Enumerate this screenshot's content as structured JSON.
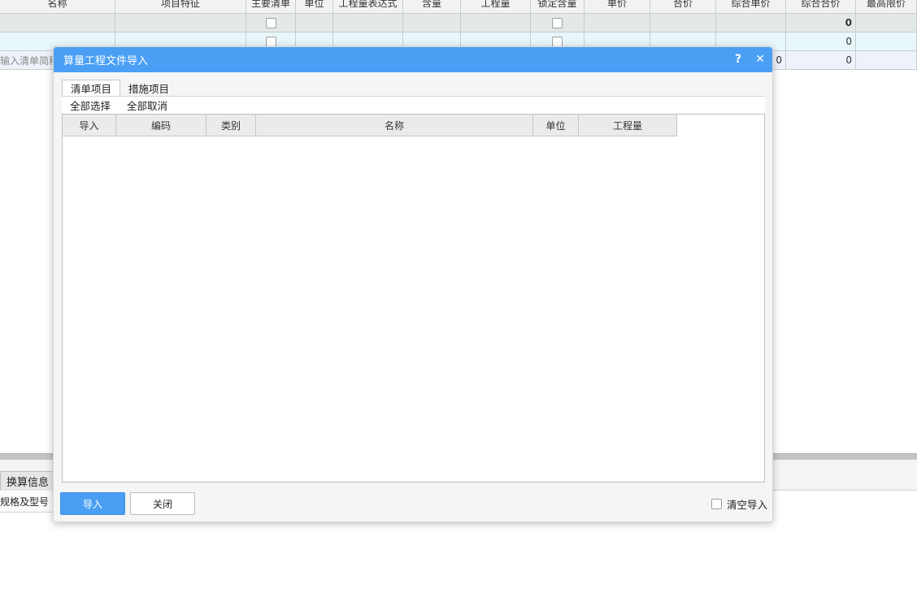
{
  "grid": {
    "headers": [
      "名称",
      "项目特征",
      "主要清单",
      "单位",
      "工程量表达式",
      "含量",
      "工程量",
      "锁定含量",
      "单价",
      "合价",
      "综合单价",
      "综合合价",
      "最高限价"
    ],
    "row1": {
      "total": "0"
    },
    "row2": {
      "total": "0"
    },
    "row3": {
      "name_placeholder": "输入清单简称",
      "unit_price": "0",
      "total": "0"
    }
  },
  "lower_panel": {
    "tab_label": "换算信息",
    "column_label": "规格及型号"
  },
  "dialog": {
    "title": "算量工程文件导入",
    "help_label": "?",
    "close_label": "✕",
    "tabs": [
      "清单项目",
      "措施项目"
    ],
    "toolbar": {
      "select_all": "全部选择",
      "deselect_all": "全部取消"
    },
    "table_headers": [
      "导入",
      "编码",
      "类别",
      "名称",
      "单位",
      "工程量"
    ],
    "import_button": "导入",
    "close_button": "关闭",
    "clear_import_label": "清空导入",
    "clear_import_checked": false
  },
  "colors": {
    "title_bar": "#4a9ff5",
    "primary_button": "#4a9ff5"
  }
}
